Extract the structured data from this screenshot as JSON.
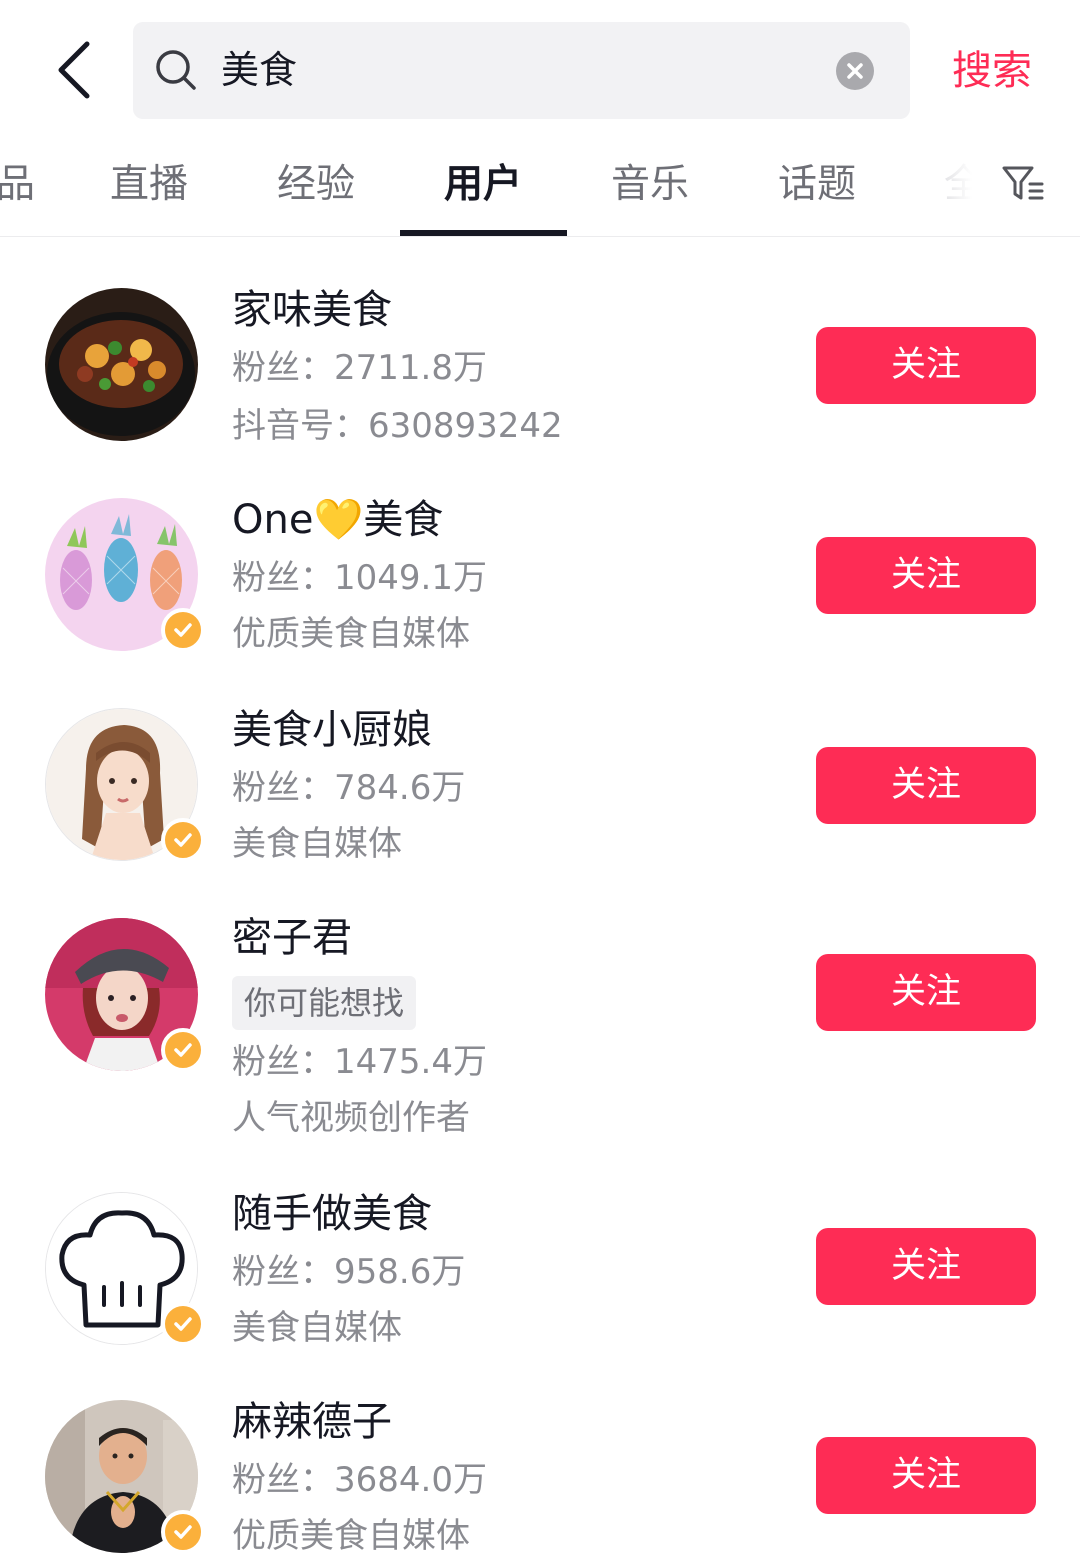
{
  "search": {
    "query": "美食",
    "submit_label": "搜索"
  },
  "tabs": [
    {
      "label": "品",
      "active": false
    },
    {
      "label": "直播",
      "active": false
    },
    {
      "label": "经验",
      "active": false
    },
    {
      "label": "用户",
      "active": true
    },
    {
      "label": "音乐",
      "active": false
    },
    {
      "label": "话题",
      "active": false
    },
    {
      "label": "全",
      "active": false
    }
  ],
  "colors": {
    "accent": "#fe2c55",
    "verified": "#fbb03b",
    "text_primary": "#161823",
    "text_secondary": "#8a8b91"
  },
  "icons": {
    "back": "back-arrow-icon",
    "search": "search-icon",
    "clear": "clear-icon",
    "filter": "filter-icon",
    "verified": "verified-badge-icon"
  },
  "users": [
    {
      "name": "家味美食",
      "followers": "粉丝：2711.8万",
      "detail": "抖音号：630893242",
      "verified": false,
      "follow_label": "关注"
    },
    {
      "name": "One💛美食",
      "followers": "粉丝：1049.1万",
      "detail": "优质美食自媒体",
      "verified": true,
      "follow_label": "关注"
    },
    {
      "name": "美食小厨娘",
      "followers": "粉丝：784.6万",
      "detail": "美食自媒体",
      "verified": true,
      "follow_label": "关注"
    },
    {
      "name": "密子君",
      "tag": "你可能想找",
      "followers": "粉丝：1475.4万",
      "detail": "人气视频创作者",
      "verified": true,
      "follow_label": "关注"
    },
    {
      "name": "随手做美食",
      "followers": "粉丝：958.6万",
      "detail": "美食自媒体",
      "verified": true,
      "follow_label": "关注"
    },
    {
      "name": "麻辣德子",
      "followers": "粉丝：3684.0万",
      "detail": "优质美食自媒体",
      "verified": true,
      "follow_label": "关注"
    }
  ]
}
